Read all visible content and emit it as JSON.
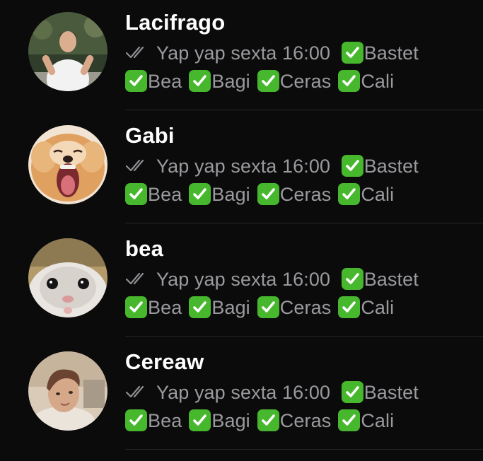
{
  "chats": [
    {
      "name": "Lacifrago",
      "avatar": "person-photo-avatar",
      "read_icon": "double-check-icon",
      "text": "Yap yap sexta 16:00",
      "line1_tags": [
        "Bastet"
      ],
      "line2_tags": [
        "Bea",
        "Bagi",
        "Ceras",
        "Cali"
      ]
    },
    {
      "name": "Gabi",
      "avatar": "dog-photo-avatar",
      "read_icon": "double-check-icon",
      "text": "Yap yap sexta 16:00",
      "line1_tags": [
        "Bastet"
      ],
      "line2_tags": [
        "Bea",
        "Bagi",
        "Ceras",
        "Cali"
      ]
    },
    {
      "name": "bea",
      "avatar": "hamster-photo-avatar",
      "read_icon": "double-check-icon",
      "text": "Yap yap sexta 16:00",
      "line1_tags": [
        "Bastet"
      ],
      "line2_tags": [
        "Bea",
        "Bagi",
        "Ceras",
        "Cali"
      ]
    },
    {
      "name": "Cereaw",
      "avatar": "person-photo-avatar",
      "read_icon": "double-check-icon",
      "text": "Yap yap sexta 16:00",
      "line1_tags": [
        "Bastet"
      ],
      "line2_tags": [
        "Bea",
        "Bagi",
        "Ceras",
        "Cali"
      ]
    }
  ],
  "colors": {
    "background": "#0b0b0b",
    "name": "#ffffff",
    "preview": "#9a9a9f",
    "check_green": "#47b82e",
    "divider": "#262626"
  }
}
